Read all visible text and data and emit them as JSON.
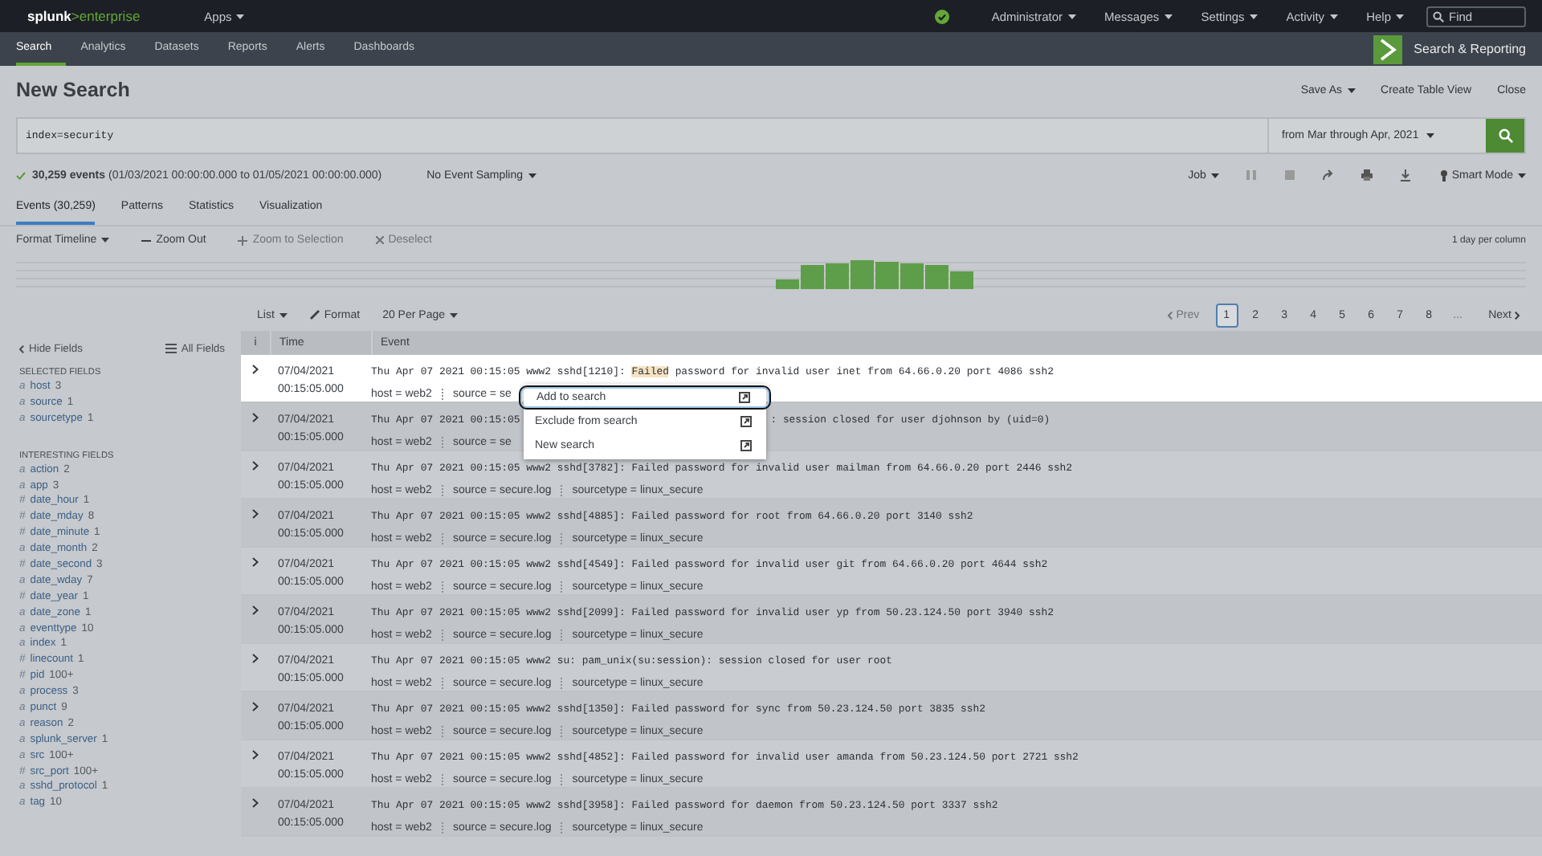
{
  "top_bar": {
    "logo_brand": "splunk",
    "logo_product": ">enterprise",
    "apps": "Apps",
    "menus": [
      "Administrator",
      "Messages",
      "Settings",
      "Activity",
      "Help"
    ],
    "find": {
      "placeholder": "Find"
    }
  },
  "nav": {
    "items": [
      {
        "label": "Search",
        "selected": true
      },
      {
        "label": "Analytics",
        "selected": false
      },
      {
        "label": "Datasets",
        "selected": false
      },
      {
        "label": "Reports",
        "selected": false
      },
      {
        "label": "Alerts",
        "selected": false
      },
      {
        "label": "Dashboards",
        "selected": false
      }
    ],
    "app_name": "Search & Reporting"
  },
  "header": {
    "title": "New Search",
    "actions": [
      {
        "label": "Save As",
        "dropdown": true
      },
      {
        "label": "Create Table View",
        "dropdown": false
      },
      {
        "label": "Close",
        "dropdown": false
      }
    ]
  },
  "search": {
    "query": "index=security",
    "time_range": "from Mar through Apr, 2021"
  },
  "status": {
    "summary": "**30,259 events** (01/03/2021 00:00:00.000 to 01/05/2021 00:00:00.000)",
    "sampling": "No Event Sampling",
    "job": "Job",
    "mode": "Smart Mode"
  },
  "tabs": [
    {
      "label": "Events (30,259)",
      "selected": true
    },
    {
      "label": "Patterns",
      "selected": false
    },
    {
      "label": "Statistics",
      "selected": false
    },
    {
      "label": "Visualization",
      "selected": false
    }
  ],
  "timeline": {
    "tools": [
      {
        "label": "Format Timeline",
        "disabled": false
      },
      {
        "label": "Zoom Out",
        "disabled": false
      },
      {
        "label": "Zoom to Selection",
        "disabled": true
      },
      {
        "label": "Deselect",
        "disabled": true
      }
    ],
    "scale": "1 day per column"
  },
  "list_toolbar": {
    "list": "List",
    "format": "Format",
    "per_page": "20 Per Page"
  },
  "pagination": {
    "prev": {
      "label": "Prev",
      "disabled": true
    },
    "pages": [
      {
        "label": "1",
        "selected": true
      },
      {
        "label": "2",
        "selected": false
      },
      {
        "label": "3",
        "selected": false
      },
      {
        "label": "4",
        "selected": false
      },
      {
        "label": "5",
        "selected": false
      },
      {
        "label": "6",
        "selected": false
      },
      {
        "label": "7",
        "selected": false
      },
      {
        "label": "8",
        "selected": false
      }
    ],
    "ellipsis": "...",
    "next": {
      "label": "Next",
      "disabled": false
    }
  },
  "sidebar": {
    "hide": "Hide Fields",
    "all": "All Fields",
    "sections": [
      {
        "title": "SELECTED FIELDS",
        "fields": [
          {
            "type": "a",
            "name": "host",
            "count": "3"
          },
          {
            "type": "a",
            "name": "source",
            "count": "1"
          },
          {
            "type": "a",
            "name": "sourcetype",
            "count": "1"
          }
        ]
      },
      {
        "title": "INTERESTING FIELDS",
        "fields": [
          {
            "type": "a",
            "name": "action",
            "count": "2"
          },
          {
            "type": "a",
            "name": "app",
            "count": "3"
          },
          {
            "type": "#",
            "name": "date_hour",
            "count": "1"
          },
          {
            "type": "#",
            "name": "date_mday",
            "count": "8"
          },
          {
            "type": "#",
            "name": "date_minute",
            "count": "1"
          },
          {
            "type": "a",
            "name": "date_month",
            "count": "2"
          },
          {
            "type": "#",
            "name": "date_second",
            "count": "3"
          },
          {
            "type": "a",
            "name": "date_wday",
            "count": "7"
          },
          {
            "type": "#",
            "name": "date_year",
            "count": "1"
          },
          {
            "type": "a",
            "name": "date_zone",
            "count": "1"
          },
          {
            "type": "a",
            "name": "eventtype",
            "count": "10"
          },
          {
            "type": "a",
            "name": "index",
            "count": "1"
          },
          {
            "type": "#",
            "name": "linecount",
            "count": "1"
          },
          {
            "type": "#",
            "name": "pid",
            "count": "100+"
          },
          {
            "type": "a",
            "name": "process",
            "count": "3"
          },
          {
            "type": "a",
            "name": "punct",
            "count": "9"
          },
          {
            "type": "a",
            "name": "reason",
            "count": "2"
          },
          {
            "type": "a",
            "name": "splunk_server",
            "count": "1"
          },
          {
            "type": "a",
            "name": "src",
            "count": "100+"
          },
          {
            "type": "#",
            "name": "src_port",
            "count": "100+"
          },
          {
            "type": "a",
            "name": "sshd_protocol",
            "count": "1"
          },
          {
            "type": "a",
            "name": "tag",
            "count": "10"
          }
        ]
      }
    ]
  },
  "events": {
    "columns": [
      "i",
      "Time",
      "Event"
    ],
    "rows": [
      {
        "selected": true,
        "date": "07/04/2021",
        "time": "00:15:05.000",
        "segments": [
          {
            "text": "Thu Apr 07 2021 00:15:05 www2 sshd[1210]: ",
            "highlighted": false,
            "after_menu": false
          },
          {
            "text": "Failed",
            "highlighted": true,
            "after_menu": false
          },
          {
            "text": " password for invalid user inet from 64.66.0.20 port 4086 ssh2",
            "highlighted": false,
            "after_menu": false
          }
        ],
        "fields": [
          "host = web2",
          "source = se"
        ]
      },
      {
        "selected": false,
        "date": "07/04/2021",
        "time": "00:15:05.000",
        "segments": [
          {
            "text": "Thu Apr 07 2021 00:15:05",
            "highlighted": false,
            "after_menu": false
          },
          {
            "text": ": session closed for user djohnson by (uid=0)",
            "highlighted": false,
            "after_menu": true
          }
        ],
        "fields": [
          "host = web2",
          "source = se"
        ]
      },
      {
        "selected": false,
        "date": "07/04/2021",
        "time": "00:15:05.000",
        "segments": [
          {
            "text": "Thu Apr 07 2021 00:15:05 www2 sshd[3782]: Failed password for invalid user mailman from 64.66.0.20 port 2446 ssh2",
            "highlighted": false,
            "after_menu": false
          }
        ],
        "fields": [
          "host = web2",
          "source = secure.log",
          "sourcetype = linux_secure"
        ]
      },
      {
        "selected": false,
        "date": "07/04/2021",
        "time": "00:15:05.000",
        "segments": [
          {
            "text": "Thu Apr 07 2021 00:15:05 www2 sshd[4885]: Failed password for root from 64.66.0.20 port 3140 ssh2",
            "highlighted": false
          }
        ],
        "fields": [
          "host = web2",
          "source = secure.log",
          "sourcetype = linux_secure"
        ]
      },
      {
        "selected": false,
        "date": "07/04/2021",
        "time": "00:15:05.000",
        "segments": [
          {
            "text": "Thu Apr 07 2021 00:15:05 www2 sshd[4549]: Failed password for invalid user git from 64.66.0.20 port 4644 ssh2",
            "highlighted": false
          }
        ],
        "fields": [
          "host = web2",
          "source = secure.log",
          "sourcetype = linux_secure"
        ]
      },
      {
        "selected": false,
        "date": "07/04/2021",
        "time": "00:15:05.000",
        "segments": [
          {
            "text": "Thu Apr 07 2021 00:15:05 www2 sshd[2099]: Failed password for invalid user yp from 50.23.124.50 port 3940 ssh2",
            "highlighted": false
          }
        ],
        "fields": [
          "host = web2",
          "source = secure.log",
          "sourcetype = linux_secure"
        ]
      },
      {
        "selected": false,
        "date": "07/04/2021",
        "time": "00:15:05.000",
        "segments": [
          {
            "text": "Thu Apr 07 2021 00:15:05 www2 su: pam_unix(su:session): session closed for user root",
            "highlighted": false
          }
        ],
        "fields": [
          "host = web2",
          "source = secure.log",
          "sourcetype = linux_secure"
        ]
      },
      {
        "selected": false,
        "date": "07/04/2021",
        "time": "00:15:05.000",
        "segments": [
          {
            "text": "Thu Apr 07 2021 00:15:05 www2 sshd[1350]: Failed password for sync from 50.23.124.50 port 3835 ssh2",
            "highlighted": false
          }
        ],
        "fields": [
          "host = web2",
          "source = secure.log",
          "sourcetype = linux_secure"
        ]
      },
      {
        "selected": false,
        "date": "07/04/2021",
        "time": "00:15:05.000",
        "segments": [
          {
            "text": "Thu Apr 07 2021 00:15:05 www2 sshd[4852]: Failed password for invalid user amanda from 50.23.124.50 port 2721 ssh2",
            "highlighted": false
          }
        ],
        "fields": [
          "host = web2",
          "source = secure.log",
          "sourcetype = linux_secure"
        ]
      },
      {
        "selected": false,
        "date": "07/04/2021",
        "time": "00:15:05.000",
        "segments": [
          {
            "text": "Thu Apr 07 2021 00:15:05 www2 sshd[3958]: Failed password for daemon from 50.23.124.50 port 3337 ssh2",
            "highlighted": false
          }
        ],
        "fields": [
          "host = web2",
          "source = secure.log",
          "sourcetype = linux_secure"
        ]
      }
    ]
  },
  "field_menu": {
    "items": [
      {
        "label": "Add to search",
        "selected": true
      },
      {
        "label": "Exclude from search",
        "selected": false
      },
      {
        "label": "New search",
        "selected": false
      }
    ]
  }
}
